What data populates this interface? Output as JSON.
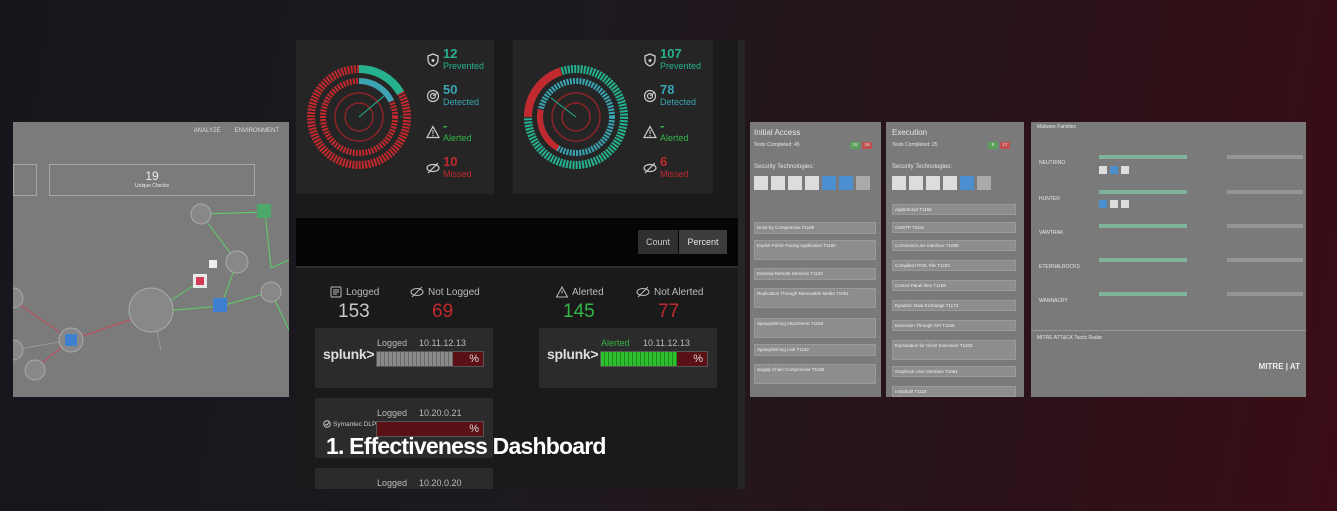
{
  "colors": {
    "prevented": "#26b18e",
    "detected": "#3aa4b3",
    "alerted": "#34b548",
    "missed": "#c0292e"
  },
  "left_panel": {
    "header_items": [
      "ANALYZE",
      "ENVIRONMENT"
    ],
    "unique_checks_value": "19",
    "unique_checks_label": "Unique Checks"
  },
  "donut1": {
    "prevented_value": "12",
    "prevented_label": "Prevented",
    "detected_value": "50",
    "detected_label": "Detected",
    "alerted_value": "-",
    "alerted_label": "Alerted",
    "missed_value": "10",
    "missed_label": "Missed",
    "center": "-"
  },
  "donut2": {
    "prevented_value": "107",
    "prevented_label": "Prevented",
    "detected_value": "78",
    "detected_label": "Detected",
    "alerted_value": "-",
    "alerted_label": "Alerted",
    "missed_value": "6",
    "missed_label": "Missed"
  },
  "toggle": {
    "count": "Count",
    "percent": "Percent"
  },
  "logging": {
    "logged_label": "Logged",
    "logged_value": "153",
    "not_logged_label": "Not Logged",
    "not_logged_value": "69"
  },
  "alerting": {
    "alerted_label": "Alerted",
    "alerted_value": "145",
    "not_alerted_label": "Not Alerted",
    "not_alerted_value": "77"
  },
  "integrations": [
    {
      "brand": "splunk>",
      "status": "Logged",
      "ip": "10.11.12.13",
      "pct": "%"
    },
    {
      "brand": "splunk>",
      "status": "Alerted",
      "ip": "10.11.12.13",
      "pct": "%"
    },
    {
      "brand": "Symantec DLP",
      "status": "Logged",
      "ip": "10.20.0.21",
      "pct": "%"
    },
    {
      "brand": "",
      "status": "Logged",
      "ip": "10.20.0.20",
      "pct": "%"
    }
  ],
  "caption": "1. Effectiveness Dashboard",
  "initial_access": {
    "title": "Initial Access",
    "tests": "Tests Completed: 45",
    "badges": [
      "28",
      "16"
    ],
    "sec_label": "Security Technologies:",
    "items": [
      "Drive-by Compromise T1189",
      "Exploit Public-Facing Application T1190",
      "External Remote Services T1133",
      "Replication Through Removable Media T1091",
      "Spearphishing Attachment T1193",
      "Spearphishing Link T1192",
      "Supply Chain Compromise T1195"
    ]
  },
  "execution": {
    "title": "Execution",
    "tests": "Tests Completed: 25",
    "badges": [
      "8",
      "17"
    ],
    "sec_label": "Security Technologies:",
    "items": [
      "AppleScript T1155",
      "CMSTP T1191",
      "Command-Line Interface T1059",
      "Compiled HTML File T1223",
      "Control Panel Item T1196",
      "Dynamic Data Exchange T1173",
      "Execution Through API T1106",
      "Exploitation for Client Execution T1203",
      "Graphical User Interface T1061",
      "InstallUtil T1118"
    ]
  },
  "malware": {
    "title": "Malware Families",
    "rows": [
      "NEUTRINO",
      "HUNTER",
      "VAWTRAK",
      "ETERNALROCKS",
      "WANNACRY"
    ],
    "section2": "MITRE ATT&CK Tactic Radar",
    "logo": "MITRE | AT"
  }
}
